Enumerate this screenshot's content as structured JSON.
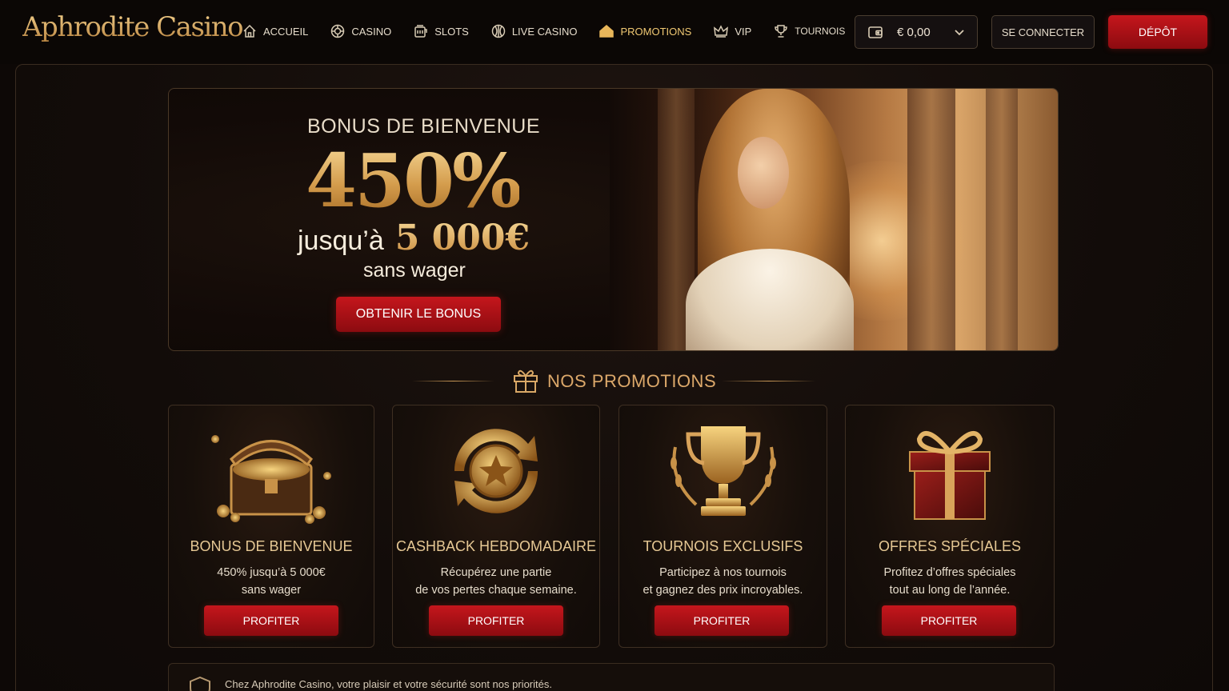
{
  "header": {
    "logo": "Aphrodite Casino",
    "nav": [
      {
        "label": "ACCUEIL",
        "icon": "home-icon"
      },
      {
        "label": "CASINO",
        "icon": "chip-icon"
      },
      {
        "label": "SLOTS",
        "icon": "slot-machine-icon"
      },
      {
        "label": "LIVE CASINO",
        "icon": "roulette-icon"
      },
      {
        "label": "PROMOTIONS",
        "icon": "gift-icon",
        "active": true
      },
      {
        "label": "VIP",
        "icon": "crown-icon"
      },
      {
        "label": "TOURNOIS",
        "icon": "trophy-icon"
      }
    ],
    "wallet_amount": "€ 0,00",
    "login_label": "SE CONNECTER",
    "deposit_label": "DÉPÔT"
  },
  "hero": {
    "subtitle": "BONUS DE BIENVENUE",
    "percent": "450%",
    "upto": "jusqu’à",
    "amount": "5 000€",
    "no_wager": "sans wager",
    "cta": "OBTENIR LE BONUS"
  },
  "promotions": {
    "title": "NOS PROMOTIONS",
    "cards": [
      {
        "title": "BONUS DE BIENVENUE",
        "line1": "450% jusqu’à 5 000€",
        "line2": "sans wager",
        "button": "PROFITER",
        "icon": "treasure-chest-icon"
      },
      {
        "title": "CASHBACK HEBDOMADAIRE",
        "line1": "Récupérez une partie",
        "line2": "de vos pertes chaque semaine.",
        "button": "PROFITER",
        "icon": "cashback-coin-icon"
      },
      {
        "title": "TOURNOIS EXCLUSIFS",
        "line1": "Participez à nos tournois",
        "line2": "et gagnez des prix incroyables.",
        "button": "PROFITER",
        "icon": "trophy-icon"
      },
      {
        "title": "OFFRES SPÉCIALES",
        "line1": "Profitez d’offres spéciales",
        "line2": "tout au long de l’année.",
        "button": "PROFITER",
        "icon": "gift-box-icon"
      }
    ]
  },
  "footer_strip": {
    "text": "Chez Aphrodite Casino, votre plaisir et votre sécurité sont nos priorités."
  },
  "colors": {
    "accent_gold": "#d9a866",
    "cta_red": "#c5161c",
    "background": "#0d0806"
  }
}
